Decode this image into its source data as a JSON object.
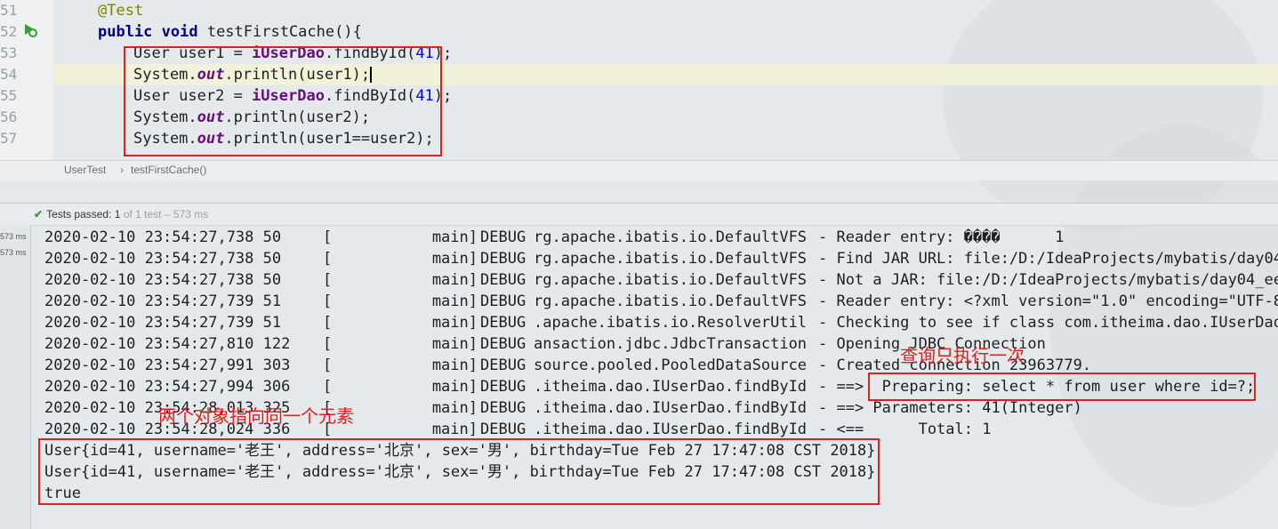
{
  "editor": {
    "line_numbers": [
      "51",
      "52",
      "53",
      "54",
      "55",
      "56",
      "57"
    ],
    "lines": {
      "l51": "@Test",
      "l52_kw": "public void",
      "l52_rest": " testFirstCache(){",
      "l53_a": "User user1 = ",
      "l53_field": "iUserDao",
      "l53_b": ".findById(",
      "l53_num": "41",
      "l53_c": ");",
      "l54_a": "System.",
      "l54_static": "out",
      "l54_b": ".println(user1);",
      "l55_a": "User user2 = ",
      "l55_field": "iUserDao",
      "l55_b": ".findById(",
      "l55_num": "41",
      "l55_c": ");",
      "l56_a": "System.",
      "l56_static": "out",
      "l56_b": ".println(user2);",
      "l57_a": "System.",
      "l57_static": "out",
      "l57_b": ".println(user1==user2);"
    }
  },
  "breadcrumb": {
    "class_name": "UserTest",
    "separator": "›",
    "method_name": "testFirstCache()"
  },
  "run_panel": {
    "status_label": "Tests passed:",
    "status_count": "1",
    "status_detail": "of 1 test – 573 ms",
    "tree_times": [
      "573 ms",
      "573 ms"
    ]
  },
  "console": {
    "log_rows": [
      {
        "ts": "2020-02-10 23:54:27,738 50",
        "thread": "[           main]",
        "level": "DEBUG",
        "logger": "rg.apache.ibatis.io.DefaultVFS",
        "msg": "- Reader entry: ����      1"
      },
      {
        "ts": "2020-02-10 23:54:27,738 50",
        "thread": "[           main]",
        "level": "DEBUG",
        "logger": "rg.apache.ibatis.io.DefaultVFS",
        "msg": "- Find JAR URL: file:/D:/IdeaProjects/mybatis/day04_"
      },
      {
        "ts": "2020-02-10 23:54:27,738 50",
        "thread": "[           main]",
        "level": "DEBUG",
        "logger": "rg.apache.ibatis.io.DefaultVFS",
        "msg": "- Not a JAR: file:/D:/IdeaProjects/mybatis/day04_ees"
      },
      {
        "ts": "2020-02-10 23:54:27,739 51",
        "thread": "[           main]",
        "level": "DEBUG",
        "logger": "rg.apache.ibatis.io.DefaultVFS",
        "msg": "- Reader entry: <?xml version=\"1.0\" encoding=\"UTF-8\""
      },
      {
        "ts": "2020-02-10 23:54:27,739 51",
        "thread": "[           main]",
        "level": "DEBUG",
        "logger": ".apache.ibatis.io.ResolverUtil",
        "msg": "- Checking to see if class com.itheima.dao.IUserDao"
      },
      {
        "ts": "2020-02-10 23:54:27,810 122",
        "thread": "[           main]",
        "level": "DEBUG",
        "logger": "ansaction.jdbc.JdbcTransaction",
        "msg": "- Opening JDBC Connection"
      },
      {
        "ts": "2020-02-10 23:54:27,991 303",
        "thread": "[           main]",
        "level": "DEBUG",
        "logger": "source.pooled.PooledDataSource",
        "msg": "- Created connection 23963779."
      },
      {
        "ts": "2020-02-10 23:54:27,994 306",
        "thread": "[           main]",
        "level": "DEBUG",
        "logger": ".itheima.dao.IUserDao.findById",
        "msg": "- ==>  Preparing: select * from user where id=?;"
      },
      {
        "ts": "2020-02-10 23:54:28,013 325",
        "thread": "[           main]",
        "level": "DEBUG",
        "logger": ".itheima.dao.IUserDao.findById",
        "msg": "- ==> Parameters: 41(Integer)"
      },
      {
        "ts": "2020-02-10 23:54:28,024 336",
        "thread": "[           main]",
        "level": "DEBUG",
        "logger": ".itheima.dao.IUserDao.findById",
        "msg": "- <==      Total: 1"
      }
    ],
    "output_lines": [
      "User{id=41, username='老王', address='北京', sex='男', birthday=Tue Feb 27 17:47:08 CST 2018}",
      "User{id=41, username='老王', address='北京', sex='男', birthday=Tue Feb 27 17:47:08 CST 2018}",
      "true"
    ]
  },
  "annotations": {
    "query_once": "查询只执行一次",
    "same_object": "两个对象指向同一个元素"
  },
  "colors": {
    "highlight": "#e0201e",
    "annotation_color": "#808000",
    "keyword": "#000080",
    "field": "#660e7a",
    "number": "#0000ff"
  }
}
